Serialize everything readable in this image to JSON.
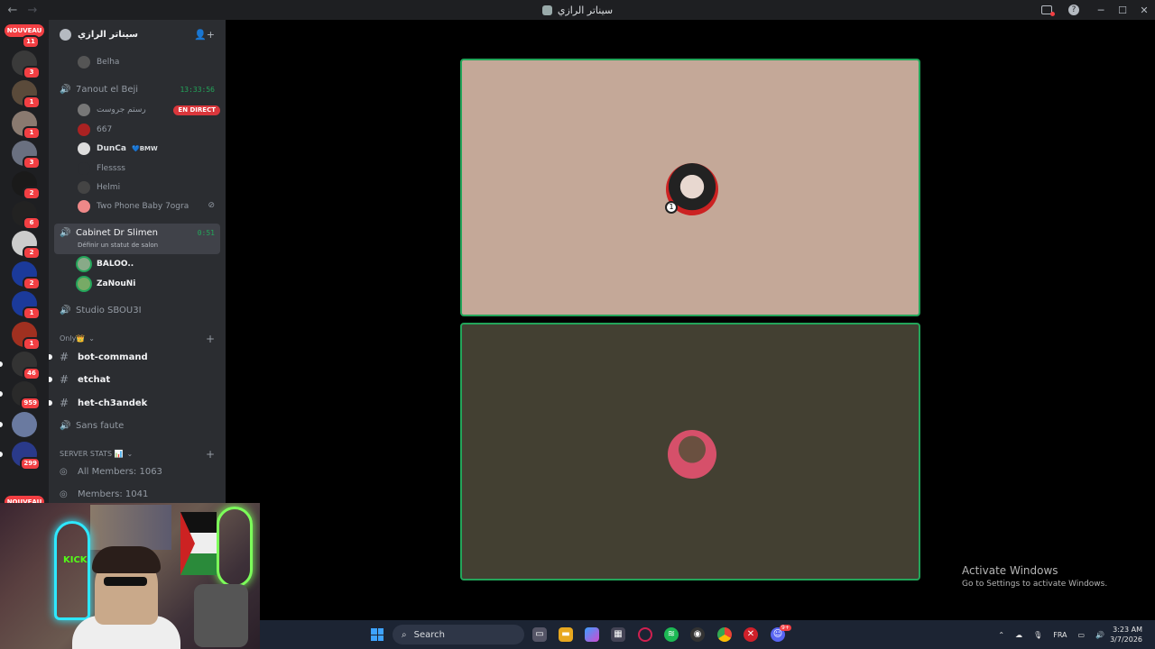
{
  "titlebar": {
    "title": "سيناتر الرازي"
  },
  "guilds": {
    "nouveau_label": "NOUVEAU",
    "top_badge": "11",
    "items": [
      {
        "badge": "3",
        "color": "#3a3a3a"
      },
      {
        "badge": "1",
        "color": "#5a4a3a"
      },
      {
        "badge": "1",
        "color": "#8a7a70"
      },
      {
        "badge": "3",
        "color": "#6a7080"
      },
      {
        "badge": "2",
        "color": "#1a1a1a"
      },
      {
        "badge": "6",
        "color": "#222"
      },
      {
        "badge": "2",
        "color": "#ccc"
      },
      {
        "badge": "2",
        "color": "#1b3a9a"
      },
      {
        "badge": "1",
        "color": "#1b3a9a"
      },
      {
        "badge": "1",
        "color": "#a03020"
      },
      {
        "badge": "46",
        "color": "#333"
      },
      {
        "badge": "959",
        "color": "#2a2a2a"
      },
      {
        "badge": "",
        "color": "#6a7aa0"
      },
      {
        "badge": "299",
        "color": "#2a3a8a"
      }
    ],
    "bottom_label": "NOUVEAU"
  },
  "server": {
    "name": "سيناتر الرازي"
  },
  "channels": {
    "belha": "Belha",
    "vc1": {
      "name": "7anout el Beji",
      "time": "13:33:56"
    },
    "vc1_users": [
      {
        "name": "رستم جروست",
        "live": "EN DIRECT"
      },
      {
        "name": "667"
      },
      {
        "name": "DunCa",
        "tag": "BMW"
      },
      {
        "name": "Flessss"
      },
      {
        "name": "Helmi"
      },
      {
        "name": "Two Phone Baby 7ogra"
      }
    ],
    "vc2": {
      "name": "Cabinet Dr Slimen",
      "time": "0:51",
      "status": "Définir un statut de salon"
    },
    "vc2_users": [
      {
        "name": "BALOO.."
      },
      {
        "name": "ZaNouNi"
      }
    ],
    "vc3": "Studio SBOU3I",
    "category1": "Only👑",
    "text_channels": [
      "bot-command",
      "etchat",
      "het-ch3andek"
    ],
    "vc4": "Sans faute",
    "category2": "SERVER STATS 📊",
    "stats": [
      "All Members: 1063",
      "Members: 1041"
    ]
  },
  "overlay": {
    "activate_title": "Activate Windows",
    "activate_sub": "Go to Settings to activate Windows."
  },
  "taskbar": {
    "search": "Search",
    "lang": "FRA",
    "time": "3:23 AM",
    "date": "3/7/2026",
    "discord_badge": "9+"
  },
  "colors": {
    "speaking": "#23a55a",
    "tile1_bg": "#c4a898",
    "tile2_bg": "#434032",
    "live": "#da373c"
  }
}
